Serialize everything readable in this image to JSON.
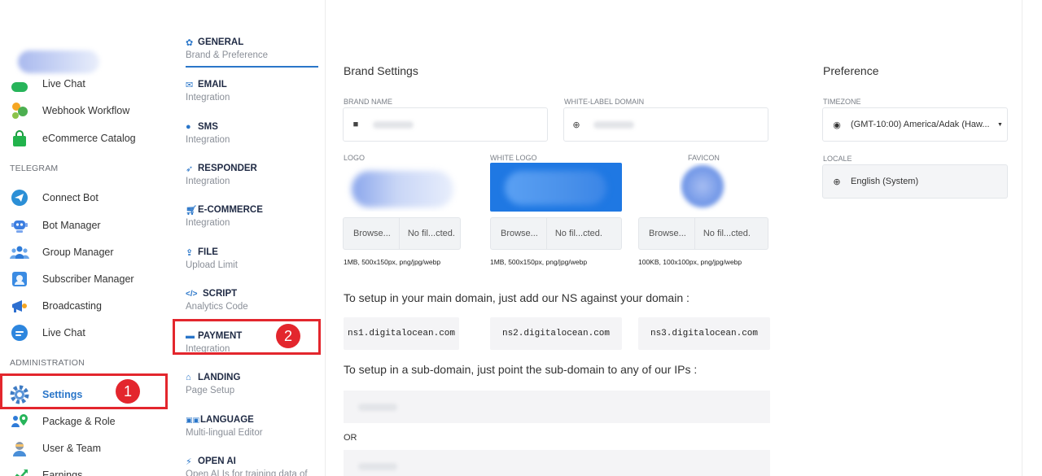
{
  "sidebar": {
    "items_top": [
      {
        "label": "Live Chat",
        "icon": "live-chat-icon"
      },
      {
        "label": "Webhook Workflow",
        "icon": "webhook-icon"
      },
      {
        "label": "eCommerce Catalog",
        "icon": "shopping-bag-icon"
      }
    ],
    "section_telegram": "TELEGRAM",
    "telegram_items": [
      {
        "label": "Connect Bot",
        "icon": "telegram-icon"
      },
      {
        "label": "Bot Manager",
        "icon": "bot-icon"
      },
      {
        "label": "Group Manager",
        "icon": "group-icon"
      },
      {
        "label": "Subscriber Manager",
        "icon": "subscriber-icon"
      },
      {
        "label": "Broadcasting",
        "icon": "broadcast-icon"
      },
      {
        "label": "Live Chat",
        "icon": "chat-bubble-icon"
      }
    ],
    "section_admin": "ADMINISTRATION",
    "admin_items": [
      {
        "label": "Settings",
        "icon": "gear-icon"
      },
      {
        "label": "Package & Role",
        "icon": "package-role-icon"
      },
      {
        "label": "User & Team",
        "icon": "user-team-icon"
      },
      {
        "label": "Earnings",
        "icon": "earnings-icon"
      }
    ],
    "badge": "1"
  },
  "settings_menu": {
    "items": [
      {
        "title": "GENERAL",
        "sub": "Brand & Preference",
        "icon": "gear-icon"
      },
      {
        "title": "EMAIL",
        "sub": "Integration",
        "icon": "envelope-icon"
      },
      {
        "title": "SMS",
        "sub": "Integration",
        "icon": "sms-icon"
      },
      {
        "title": "RESPONDER",
        "sub": "Integration",
        "icon": "paper-plane-icon"
      },
      {
        "title": "E-COMMERCE",
        "sub": "Integration",
        "icon": "cart-icon"
      },
      {
        "title": "FILE",
        "sub": "Upload Limit",
        "icon": "upload-icon"
      },
      {
        "title": "SCRIPT",
        "sub": "Analytics Code",
        "icon": "code-icon"
      },
      {
        "title": "PAYMENT",
        "sub": "Integration",
        "icon": "credit-card-icon"
      },
      {
        "title": "LANDING",
        "sub": "Page Setup",
        "icon": "home-icon"
      },
      {
        "title": "LANGUAGE",
        "sub": "Multi-lingual Editor",
        "icon": "language-icon"
      },
      {
        "title": "OPEN AI",
        "sub": "Open AI Is for training data of",
        "icon": "ai-icon"
      }
    ],
    "badge": "2"
  },
  "brand": {
    "title": "Brand Settings",
    "brand_name_label": "BRAND NAME",
    "domain_label": "WHITE-LABEL DOMAIN",
    "logo_label": "LOGO",
    "white_logo_label": "WHITE LOGO",
    "favicon_label": "FAVICON",
    "browse": "Browse...",
    "no_file": "No fil...cted.",
    "logo_hint": "1MB, 500x150px, png/jpg/webp",
    "white_logo_hint": "1MB, 500x150px, png/jpg/webp",
    "favicon_hint": "100KB, 100x100px, png/jpg/webp",
    "ns_text": "To setup in your main domain, just add our NS against your domain :",
    "ns": [
      "ns1.digitalocean.com",
      "ns2.digitalocean.com",
      "ns3.digitalocean.com"
    ],
    "sub_text": "To setup in a sub-domain, just point the sub-domain to any of our IPs :",
    "or": "OR"
  },
  "preference": {
    "title": "Preference",
    "timezone_label": "TIMEZONE",
    "timezone_value": "(GMT-10:00) America/Adak (Haw...",
    "locale_label": "LOCALE",
    "locale_value": "English (System)"
  },
  "colors": {
    "accent": "#2a76c9",
    "highlight": "#e3262d"
  }
}
